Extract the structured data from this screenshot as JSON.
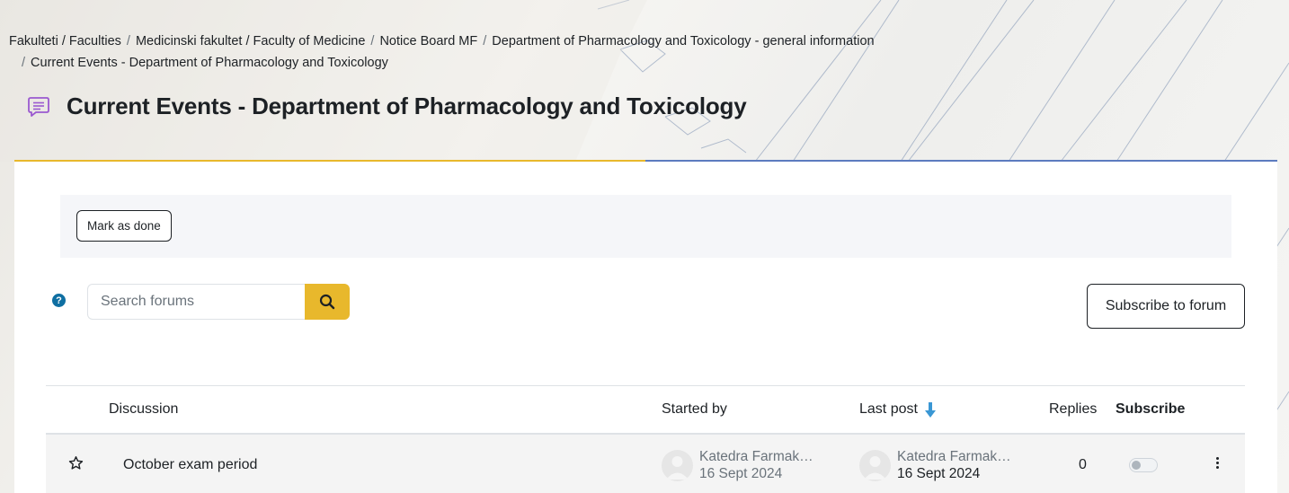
{
  "breadcrumb": [
    {
      "label": "Fakulteti / Faculties"
    },
    {
      "label": "Medicinski fakultet / Faculty of Medicine"
    },
    {
      "label": "Notice Board MF"
    },
    {
      "label": "Department of Pharmacology and Toxicology - general information"
    },
    {
      "label": "Current Events - Department of Pharmacology and Toxicology"
    }
  ],
  "page": {
    "title": "Current Events - Department of Pharmacology and Toxicology",
    "title_icon": "forum-speech-bubble-icon"
  },
  "completion": {
    "mark_done_label": "Mark as done"
  },
  "search": {
    "placeholder": "Search forums",
    "value": "",
    "button_icon": "search-icon"
  },
  "help": {
    "icon": "question-circle-icon",
    "glyph": "?"
  },
  "subscribe_forum_label": "Subscribe to forum",
  "table": {
    "headers": {
      "discussion": "Discussion",
      "started_by": "Started by",
      "last_post": "Last post",
      "replies": "Replies",
      "subscribe": "Subscribe"
    },
    "sort_icon": "arrow-down-icon",
    "rows": [
      {
        "title": "October exam period",
        "starred": false,
        "started_by": {
          "name": "Katedra Farmak…",
          "date": "16 Sept 2024"
        },
        "last_post": {
          "name": "Katedra Farmak…",
          "date": "16 Sept 2024"
        },
        "replies": "0",
        "subscribed": false
      }
    ]
  },
  "colors": {
    "accent_yellow": "#e8b82c",
    "accent_blue": "#5c7bbf",
    "help_blue": "#0f6fa2",
    "sort_arrow": "#3a97d4",
    "forum_icon": "#9b59d0"
  }
}
